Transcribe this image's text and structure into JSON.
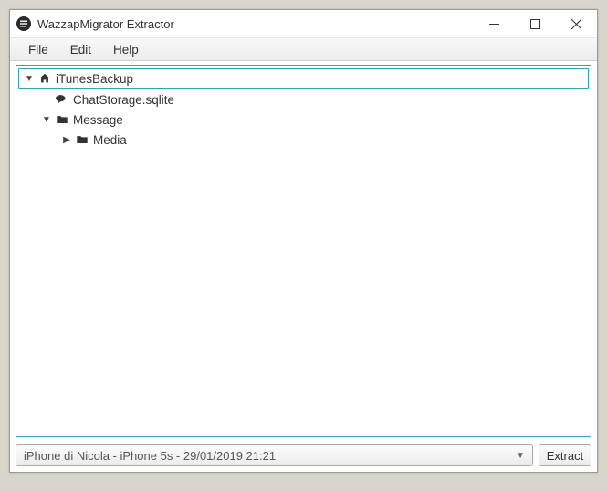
{
  "window": {
    "title": "WazzapMigrator Extractor"
  },
  "menu": {
    "file": "File",
    "edit": "Edit",
    "help": "Help"
  },
  "tree": {
    "root": {
      "label": "iTunesBackup"
    },
    "chatstorage": {
      "label": "ChatStorage.sqlite"
    },
    "message": {
      "label": "Message"
    },
    "media": {
      "label": "Media"
    }
  },
  "bottom": {
    "selected_backup": "iPhone di Nicola - iPhone 5s - 29/01/2019 21:21",
    "extract_label": "Extract"
  }
}
